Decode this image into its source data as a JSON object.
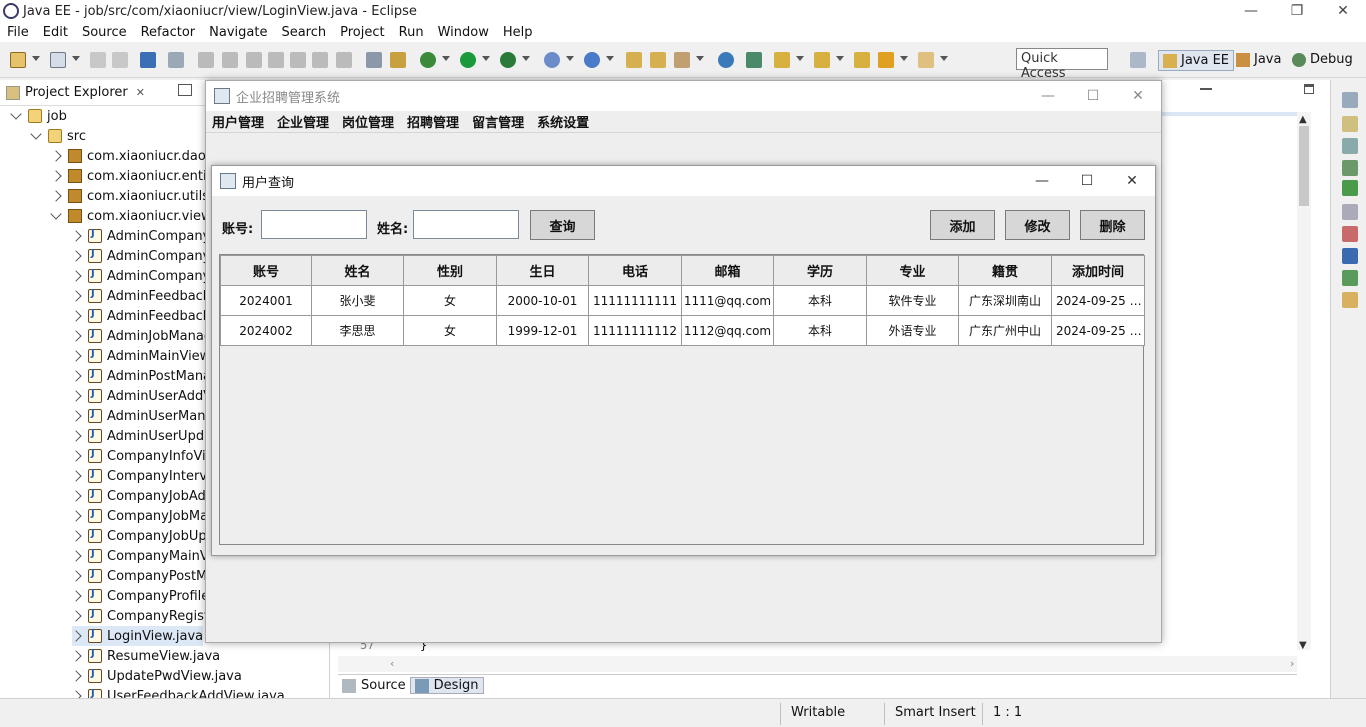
{
  "eclipse": {
    "title": "Java EE - job/src/com/xiaoniucr/view/LoginView.java - Eclipse",
    "menu": [
      "File",
      "Edit",
      "Source",
      "Refactor",
      "Navigate",
      "Search",
      "Project",
      "Run",
      "Window",
      "Help"
    ],
    "quick_access": "Quick Access",
    "perspectives": [
      "Java EE",
      "Java",
      "Debug"
    ]
  },
  "explorer": {
    "title": "Project Explorer",
    "project": "job",
    "src": "src",
    "packages": [
      "com.xiaoniucr.dao",
      "com.xiaoniucr.entity",
      "com.xiaoniucr.utils",
      "com.xiaoniucr.view"
    ],
    "files": [
      "AdminCompanyA",
      "AdminCompanyM",
      "AdminCompanyU",
      "AdminFeedbackM",
      "AdminFeedbackR",
      "AdminJobManag",
      "AdminMainView.j",
      "AdminPostManag",
      "AdminUserAddVi",
      "AdminUserManag",
      "AdminUserUpdat",
      "CompanyInfoView",
      "CompanyIntervie",
      "CompanyJobAdd",
      "CompanyJobMar",
      "CompanyJobUpd",
      "CompanyMainVie",
      "CompanyPostMa",
      "CompanyProfileV",
      "CompanyRegiste",
      "LoginView.java",
      "ResumeView.java",
      "UpdatePwdView.java",
      "UserFeedbackAddView.java"
    ]
  },
  "editor": {
    "line_no": "57",
    "line_text": "}",
    "tabs": [
      "Source",
      "Design"
    ]
  },
  "status": {
    "writable": "Writable",
    "insert": "Smart Insert",
    "pos": "1 : 1"
  },
  "frame": {
    "title": "企业招聘管理系统",
    "menu": [
      "用户管理",
      "企业管理",
      "岗位管理",
      "招聘管理",
      "留言管理",
      "系统设置"
    ]
  },
  "dialog": {
    "title": "用户查询",
    "account_label": "账号:",
    "name_label": "姓名:",
    "query_btn": "查询",
    "add_btn": "添加",
    "edit_btn": "修改",
    "delete_btn": "删除",
    "columns": [
      "账号",
      "姓名",
      "性别",
      "生日",
      "电话",
      "邮箱",
      "学历",
      "专业",
      "籍贯",
      "添加时间"
    ],
    "rows": [
      [
        "2024001",
        "张小斐",
        "女",
        "2000-10-01",
        "11111111111",
        "1111@qq.com",
        "本科",
        "软件专业",
        "广东深圳南山",
        "2024-09-25 1..."
      ],
      [
        "2024002",
        "李思思",
        "女",
        "1999-12-01",
        "11111111112",
        "1112@qq.com",
        "本科",
        "外语专业",
        "广东广州中山",
        "2024-09-25 1..."
      ]
    ]
  }
}
